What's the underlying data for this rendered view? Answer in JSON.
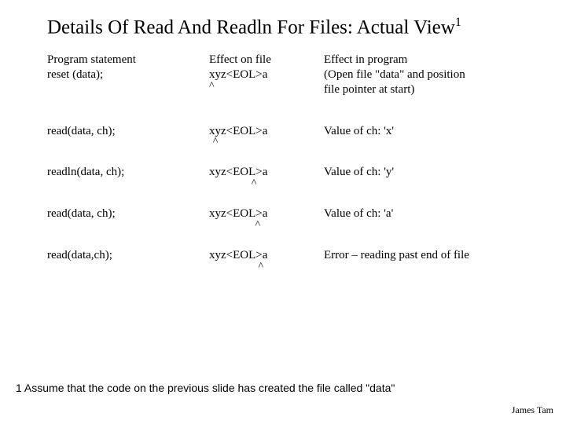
{
  "title_main": "Details Of Read And Readln For Files: Actual View",
  "title_sup": "1",
  "header": {
    "stmt_l1": "Program statement",
    "stmt_l2": "reset (data);",
    "file_l1": "Effect on file",
    "file_l2": "xyz<EOL>a",
    "eff_l1": "Effect in program",
    "eff_l2": "(Open file \"data\" and position",
    "eff_l3": "file pointer at start)"
  },
  "rows": [
    {
      "stmt": "read(data, ch);",
      "file": "xyz<EOL>a",
      "caret_ch": 0.7,
      "effect": "Value of ch: 'x'"
    },
    {
      "stmt": "readln(data, ch);",
      "file": "xyz<EOL>a",
      "caret_ch": 8,
      "effect": "Value of ch: 'y'"
    },
    {
      "stmt": "read(data, ch);",
      "file": "xyz<EOL>a",
      "caret_ch": 8.7,
      "effect": "Value of ch: 'a'"
    },
    {
      "stmt": "read(data,ch);",
      "file": "xyz<EOL>a",
      "caret_ch": 9.3,
      "effect": "Error – reading past end of file"
    }
  ],
  "header_caret_ch": 0,
  "caret_glyph": "^",
  "footnote": "1 Assume that the code on the previous slide has created the file called \"data\"",
  "author": "James Tam"
}
